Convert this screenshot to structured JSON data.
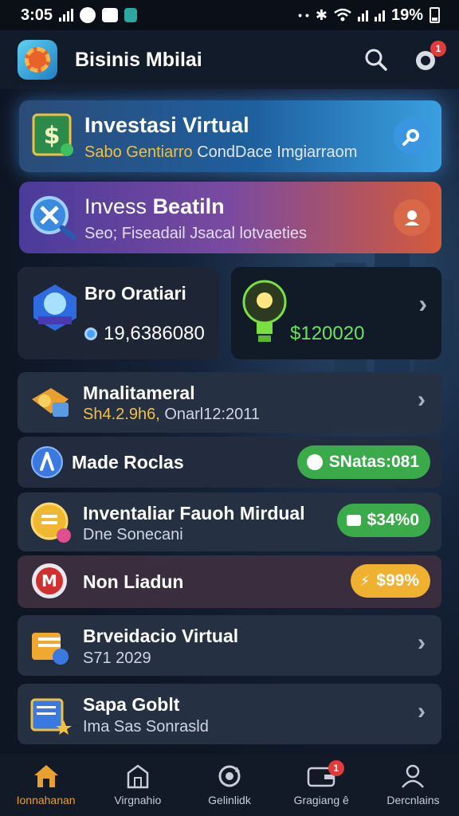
{
  "status_bar": {
    "time": "3:05",
    "battery": "19%"
  },
  "header": {
    "title": "Bisinis Mbilai",
    "notification_count": "1"
  },
  "cards": {
    "invest": {
      "title": "Investasi Virtual",
      "sub_a": "Sabo Gentiarro",
      "sub_b": "CondDace Imgiarraom",
      "color": "#1e5f9e"
    },
    "beat": {
      "title_a": "Invess",
      "title_b": "Beatiln",
      "subtitle": "Seo; Fiseadail Jsacal lotvaeties",
      "color": "#7a4aa0"
    },
    "stat": {
      "title": "Bro Oratiari",
      "value": "19,6386080"
    },
    "bulb": {
      "value": "$120020"
    }
  },
  "rows": [
    {
      "title": "Mnalitameral",
      "sub_a": "Sh4.2.9h6,",
      "sub_b": "Onarl12:2011"
    },
    {
      "title": "Made Roclas",
      "pill": "SNatas:081",
      "pill_color": "#3aaa4a"
    },
    {
      "title": "Inventaliar Fauoh Mirdual",
      "subtitle": "Dne Sonecani",
      "pill": "$34%0",
      "pill_color": "#3aaa4a"
    },
    {
      "title": "Non Liadun",
      "pill": "$99%",
      "pill_color": "#f0b030"
    },
    {
      "title": "Brveidacio Virtual",
      "subtitle": "S71 2029"
    },
    {
      "title": "Sapa Goblt",
      "subtitle": "Ima Sas Sonrasld"
    }
  ],
  "nav": [
    {
      "label": "Ionnahanan",
      "icon": "home-icon",
      "active": true
    },
    {
      "label": "Virgnahio",
      "icon": "store-icon"
    },
    {
      "label": "Gelinlidk",
      "icon": "refresh-icon"
    },
    {
      "label": "Gragiang ê",
      "icon": "wallet-icon",
      "badge": "1"
    },
    {
      "label": "Dercnlains",
      "icon": "profile-icon"
    }
  ]
}
